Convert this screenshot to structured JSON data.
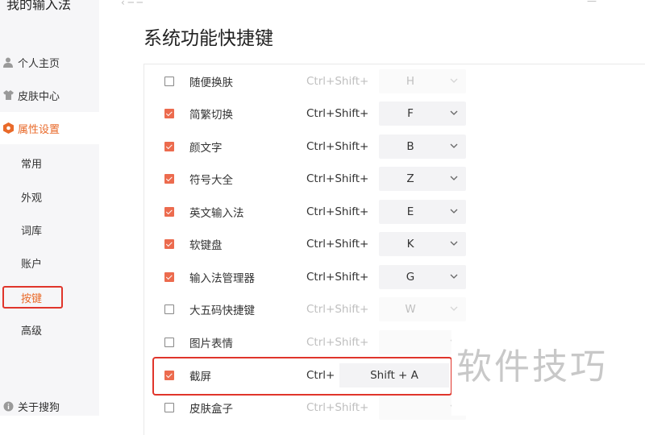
{
  "app": {
    "title": "我的输入法"
  },
  "sidebar": {
    "nav": [
      {
        "label": "个人主页",
        "icon": "user-icon"
      },
      {
        "label": "皮肤中心",
        "icon": "shirt-icon"
      },
      {
        "label": "属性设置",
        "icon": "hexagon-settings-icon",
        "active": true
      }
    ],
    "sub": [
      "常用",
      "外观",
      "词库",
      "账户",
      "按键",
      "高级"
    ],
    "selected_sub": "按键",
    "footer": {
      "label": "关于搜狗",
      "icon": "info-icon"
    }
  },
  "page": {
    "title": "系统功能快捷键"
  },
  "shortcuts": [
    {
      "label": "随便换肤",
      "modifier": "Ctrl+Shift+",
      "key": "H",
      "checked": false
    },
    {
      "label": "简繁切换",
      "modifier": "Ctrl+Shift+",
      "key": "F",
      "checked": true
    },
    {
      "label": "颜文字",
      "modifier": "Ctrl+Shift+",
      "key": "B",
      "checked": true
    },
    {
      "label": "符号大全",
      "modifier": "Ctrl+Shift+",
      "key": "Z",
      "checked": true
    },
    {
      "label": "英文输入法",
      "modifier": "Ctrl+Shift+",
      "key": "E",
      "checked": true
    },
    {
      "label": "软键盘",
      "modifier": "Ctrl+Shift+",
      "key": "K",
      "checked": true
    },
    {
      "label": "输入法管理器",
      "modifier": "Ctrl+Shift+",
      "key": "G",
      "checked": true
    },
    {
      "label": "大五码快捷键",
      "modifier": "Ctrl+Shift+",
      "key": "W",
      "checked": false
    },
    {
      "label": "图片表情",
      "modifier": "Ctrl+Shift+",
      "key": "",
      "checked": false
    },
    {
      "label": "截屏",
      "modifier": "Ctrl+",
      "key": "Shift + A",
      "checked": true
    },
    {
      "label": "皮肤盒子",
      "modifier": "Ctrl+Shift+",
      "key": "",
      "checked": false
    }
  ],
  "watermark": "软件技巧",
  "colors": {
    "accent": "#e96a2a",
    "checkbox": "#ec6b4e",
    "highlight": "#e0352b"
  }
}
